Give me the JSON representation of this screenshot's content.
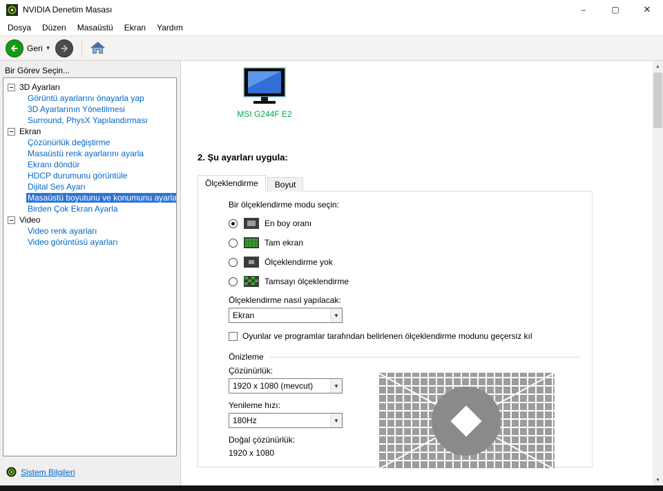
{
  "window": {
    "title": "NVIDIA Denetim Masası",
    "minimize_glyph": "–",
    "maximize_glyph": "▢",
    "close_glyph": "✕"
  },
  "menubar": {
    "items": [
      "Dosya",
      "Düzen",
      "Masaüstü",
      "Ekran",
      "Yardım"
    ]
  },
  "toolbar": {
    "back_label": "Geri",
    "caret_glyph": "▼"
  },
  "sidebar": {
    "header": "Bir Görev Seçin...",
    "groups": [
      {
        "label": "3D Ayarları",
        "items": [
          "Görüntü ayarlarını önayarla yap",
          "3D Ayarlarının Yönetilmesi",
          "Surround, PhysX Yapılandırması"
        ]
      },
      {
        "label": "Ekran",
        "items": [
          "Çözünürlük değiştirme",
          "Masaüstü renk ayarlarını ayarla",
          "Ekranı döndür",
          "HDCP durumunu görüntüle",
          "Dijital Ses Ayarı",
          "Masaüstü boyutunu ve konumunu ayarla",
          "Birden Çok Ekran Ayarla"
        ]
      },
      {
        "label": "Video",
        "items": [
          "Video renk ayarları",
          "Video görüntüsü ayarları"
        ]
      }
    ],
    "selected_item": "Masaüstü boyutunu ve konumunu ayarla",
    "footer_link": "Sistem Bilgileri"
  },
  "main": {
    "display_name": "MSI G244F E2",
    "section_title": "2. Şu ayarları uygula:",
    "tabs": [
      {
        "label": "Ölçeklendirme",
        "active": true
      },
      {
        "label": "Boyut",
        "active": false
      }
    ],
    "scaling": {
      "prompt": "Bir ölçeklendirme modu seçin:",
      "modes": [
        {
          "label": "En boy oranı",
          "selected": true
        },
        {
          "label": "Tam ekran",
          "selected": false
        },
        {
          "label": "Ölçeklendirme yok",
          "selected": false
        },
        {
          "label": "Tamsayı ölçeklendirme",
          "selected": false
        }
      ],
      "perform_on_label": "Ölçeklendirme nasıl yapılacak:",
      "perform_on_value": "Ekran",
      "override_label": "Oyunlar ve programlar tarafından belirlenen ölçeklendirme modunu geçersiz kıl",
      "override_checked": false
    },
    "preview": {
      "title": "Önizleme",
      "resolution_label": "Çözünürlük:",
      "resolution_value": "1920 x 1080 (mevcut)",
      "refresh_label": "Yenileme hızı:",
      "refresh_value": "180Hz",
      "native_label": "Doğal çözünürlük:",
      "native_value": "1920 x 1080"
    }
  },
  "colors": {
    "selection_blue": "#2e74d6",
    "tree_link_blue": "#0066cc",
    "display_name_green": "#00a651",
    "nvidia_green": "#76b900"
  }
}
